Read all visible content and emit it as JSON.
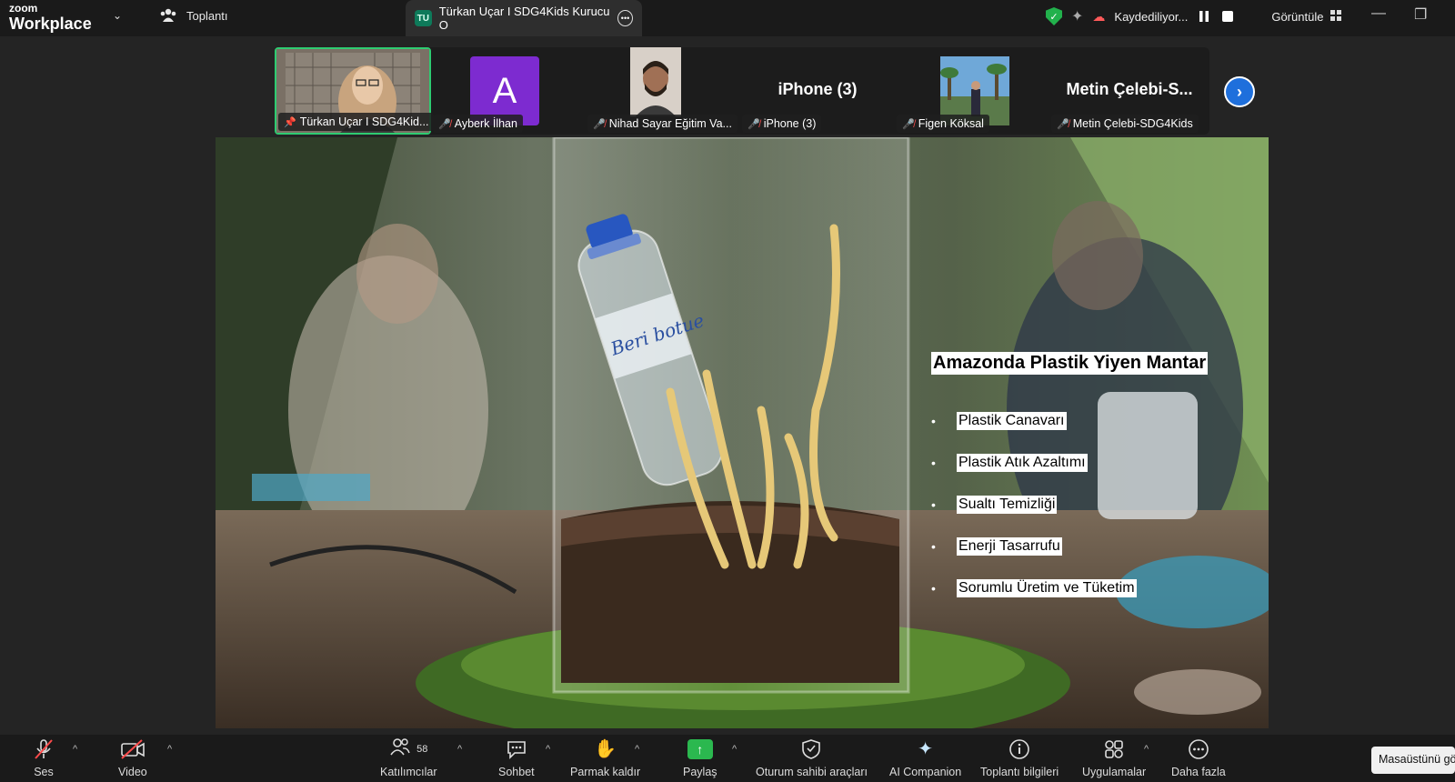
{
  "app": {
    "logo_top": "zoom",
    "logo_bottom": "Workplace"
  },
  "topbar": {
    "meeting_label": "Toplantı",
    "tab_badge": "TU",
    "tab_title": "Türkan Uçar I SDG4Kids Kurucu O",
    "recording_label": "Kaydediliyor...",
    "view_label": "Görüntüle"
  },
  "participants": [
    {
      "name": "Türkan Uçar I SDG4Kid...",
      "pinned": true,
      "video": true
    },
    {
      "name": "Ayberk İlhan",
      "avatar_letter": "A",
      "avatar_color": "#7d2bd0"
    },
    {
      "name": "Nihad Sayar Eğitim Va...",
      "video": true
    },
    {
      "name": "iPhone (3)",
      "display": "iPhone (3)"
    },
    {
      "name": "Figen Köksal",
      "video": true
    },
    {
      "name": "Metin Çelebi-SDG4Kids",
      "display": "Metin  Çelebi-S..."
    }
  ],
  "slide": {
    "title": "Amazonda Plastik Yiyen Mantar",
    "bottle_text": "Beri botue",
    "bullets": [
      "Plastik Canavarı",
      "Plastik Atık Azaltımı",
      "Sualtı Temizliği",
      "Enerji Tasarrufu",
      "Sorumlu Üretim ve Tüketim"
    ]
  },
  "toolbar": {
    "audio": "Ses",
    "video": "Video",
    "participants": "Katılımcılar",
    "participants_count": "58",
    "chat": "Sohbet",
    "raise_hand": "Parmak kaldır",
    "share": "Paylaş",
    "host_tools": "Oturum sahibi araçları",
    "ai_companion": "AI Companion",
    "meeting_info": "Toplantı bilgileri",
    "apps": "Uygulamalar",
    "more": "Daha fazla"
  },
  "tooltip": "Masaüstünü gö",
  "colors": {
    "accent_green": "#2ecc71",
    "share_green": "#2bb84f",
    "mute_red": "#ff4b4b",
    "next_blue": "#1e6fdc"
  }
}
